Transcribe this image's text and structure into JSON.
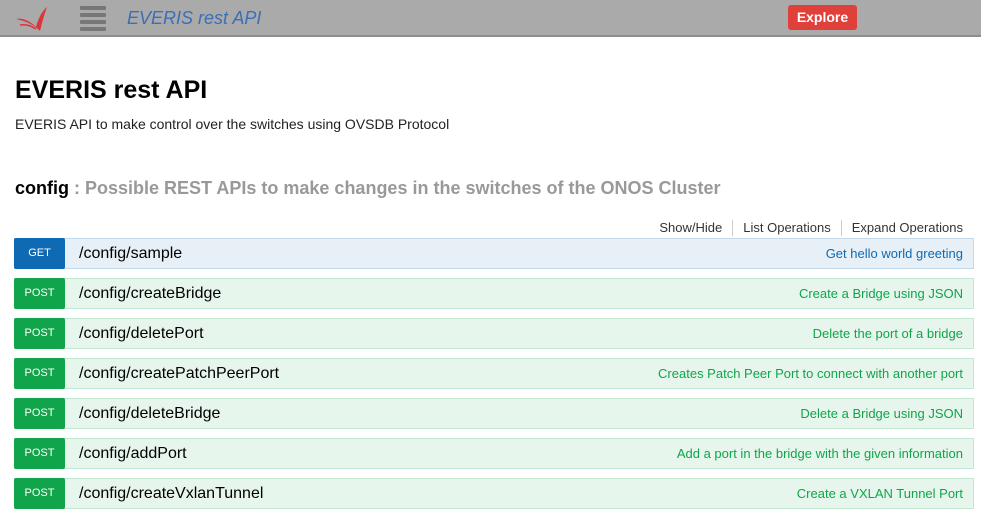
{
  "header": {
    "app_title": "EVERIS rest API",
    "explore_label": "Explore",
    "logo_icon": "bird-logo-icon",
    "menu_icon": "hamburger-menu-icon"
  },
  "info": {
    "title": "EVERIS rest API",
    "description": "EVERIS API to make control over the switches using OVSDB Protocol"
  },
  "resource": {
    "name": "config",
    "description": ": Possible REST APIs to make changes in the switches of the ONOS Cluster",
    "links": [
      "Show/Hide",
      "List Operations",
      "Expand Operations"
    ]
  },
  "operations": [
    {
      "method": "GET",
      "path": "/config/sample",
      "summary": "Get hello world greeting"
    },
    {
      "method": "POST",
      "path": "/config/createBridge",
      "summary": "Create a Bridge using JSON"
    },
    {
      "method": "POST",
      "path": "/config/deletePort",
      "summary": "Delete the port of a bridge"
    },
    {
      "method": "POST",
      "path": "/config/createPatchPeerPort",
      "summary": "Creates Patch Peer Port to connect with another port"
    },
    {
      "method": "POST",
      "path": "/config/deleteBridge",
      "summary": "Delete a Bridge using JSON"
    },
    {
      "method": "POST",
      "path": "/config/addPort",
      "summary": "Add a port in the bridge with the given information"
    },
    {
      "method": "POST",
      "path": "/config/createVxlanTunnel",
      "summary": "Create a VXLAN Tunnel Port"
    }
  ],
  "colors": {
    "get": "#0f6ab4",
    "post": "#10a54a",
    "explore": "#e0403a",
    "header": "#aaaaaa"
  }
}
